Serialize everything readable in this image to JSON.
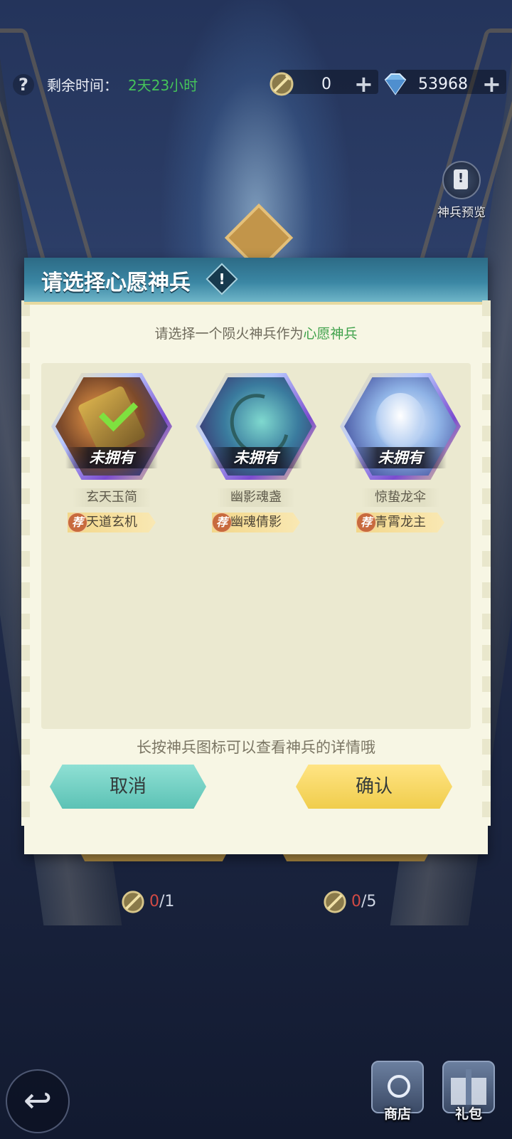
{
  "topbar": {
    "time_label": "剩余时间：",
    "time_value": "2天23小时",
    "token_count": "0",
    "gem_count": "53968"
  },
  "preview": {
    "label": "神兵预览"
  },
  "dialog": {
    "title": "请选择心愿神兵",
    "subtitle_prefix": "请选择一个陨火神兵作为",
    "subtitle_highlight": "心愿神兵",
    "items": [
      {
        "name": "玄天玉简",
        "status": "未拥有",
        "hero": "天道玄机",
        "rec_badge": "荐",
        "selected": true
      },
      {
        "name": "幽影魂盏",
        "status": "未拥有",
        "hero": "幽魂倩影",
        "rec_badge": "荐",
        "selected": false
      },
      {
        "name": "惊蛰龙伞",
        "status": "未拥有",
        "hero": "青霄龙主",
        "rec_badge": "荐",
        "selected": false
      }
    ],
    "hint": "长按神兵图标可以查看神兵的详情哦",
    "cancel_label": "取消",
    "confirm_label": "确认"
  },
  "behind": {
    "counter_left_used": "0",
    "counter_left_total": "/1",
    "counter_right_used": "0",
    "counter_right_total": "/5"
  },
  "bottom_nav": {
    "shop_label": "商店",
    "gift_label": "礼包"
  },
  "colors": {
    "accent_green": "#3ea14a",
    "time_green": "#45c35a",
    "cancel": "#6fcfc2",
    "confirm": "#f6d65e",
    "header_blue": "#3a86a3"
  }
}
